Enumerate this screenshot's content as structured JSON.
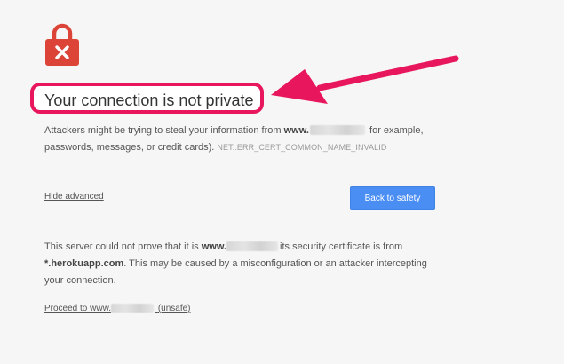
{
  "header": {
    "title": "Your connection is not private",
    "icon": "lock-error-icon",
    "icon_color": "#db4437"
  },
  "intro": {
    "text_before": "Attackers might be trying to steal your information from",
    "domain_prefix": "www.",
    "text_after": "for example, passwords, messages, or credit cards).",
    "error_code": "NET::ERR_CERT_COMMON_NAME_INVALID"
  },
  "actions": {
    "hide_advanced": "Hide advanced",
    "back_to_safety": "Back to safety",
    "button_color": "#4a8ef4"
  },
  "details": {
    "text1": "This server could not prove that it is",
    "domain_prefix": "www.",
    "text2": "its security certificate is from",
    "cert_domain": "*.herokuapp.com",
    "text3": ". This may be caused by a misconfiguration or an attacker intercepting your connection."
  },
  "proceed": {
    "prefix": "Proceed to www.",
    "suffix": "(unsafe)"
  },
  "annotation": {
    "color": "#e8175d"
  }
}
